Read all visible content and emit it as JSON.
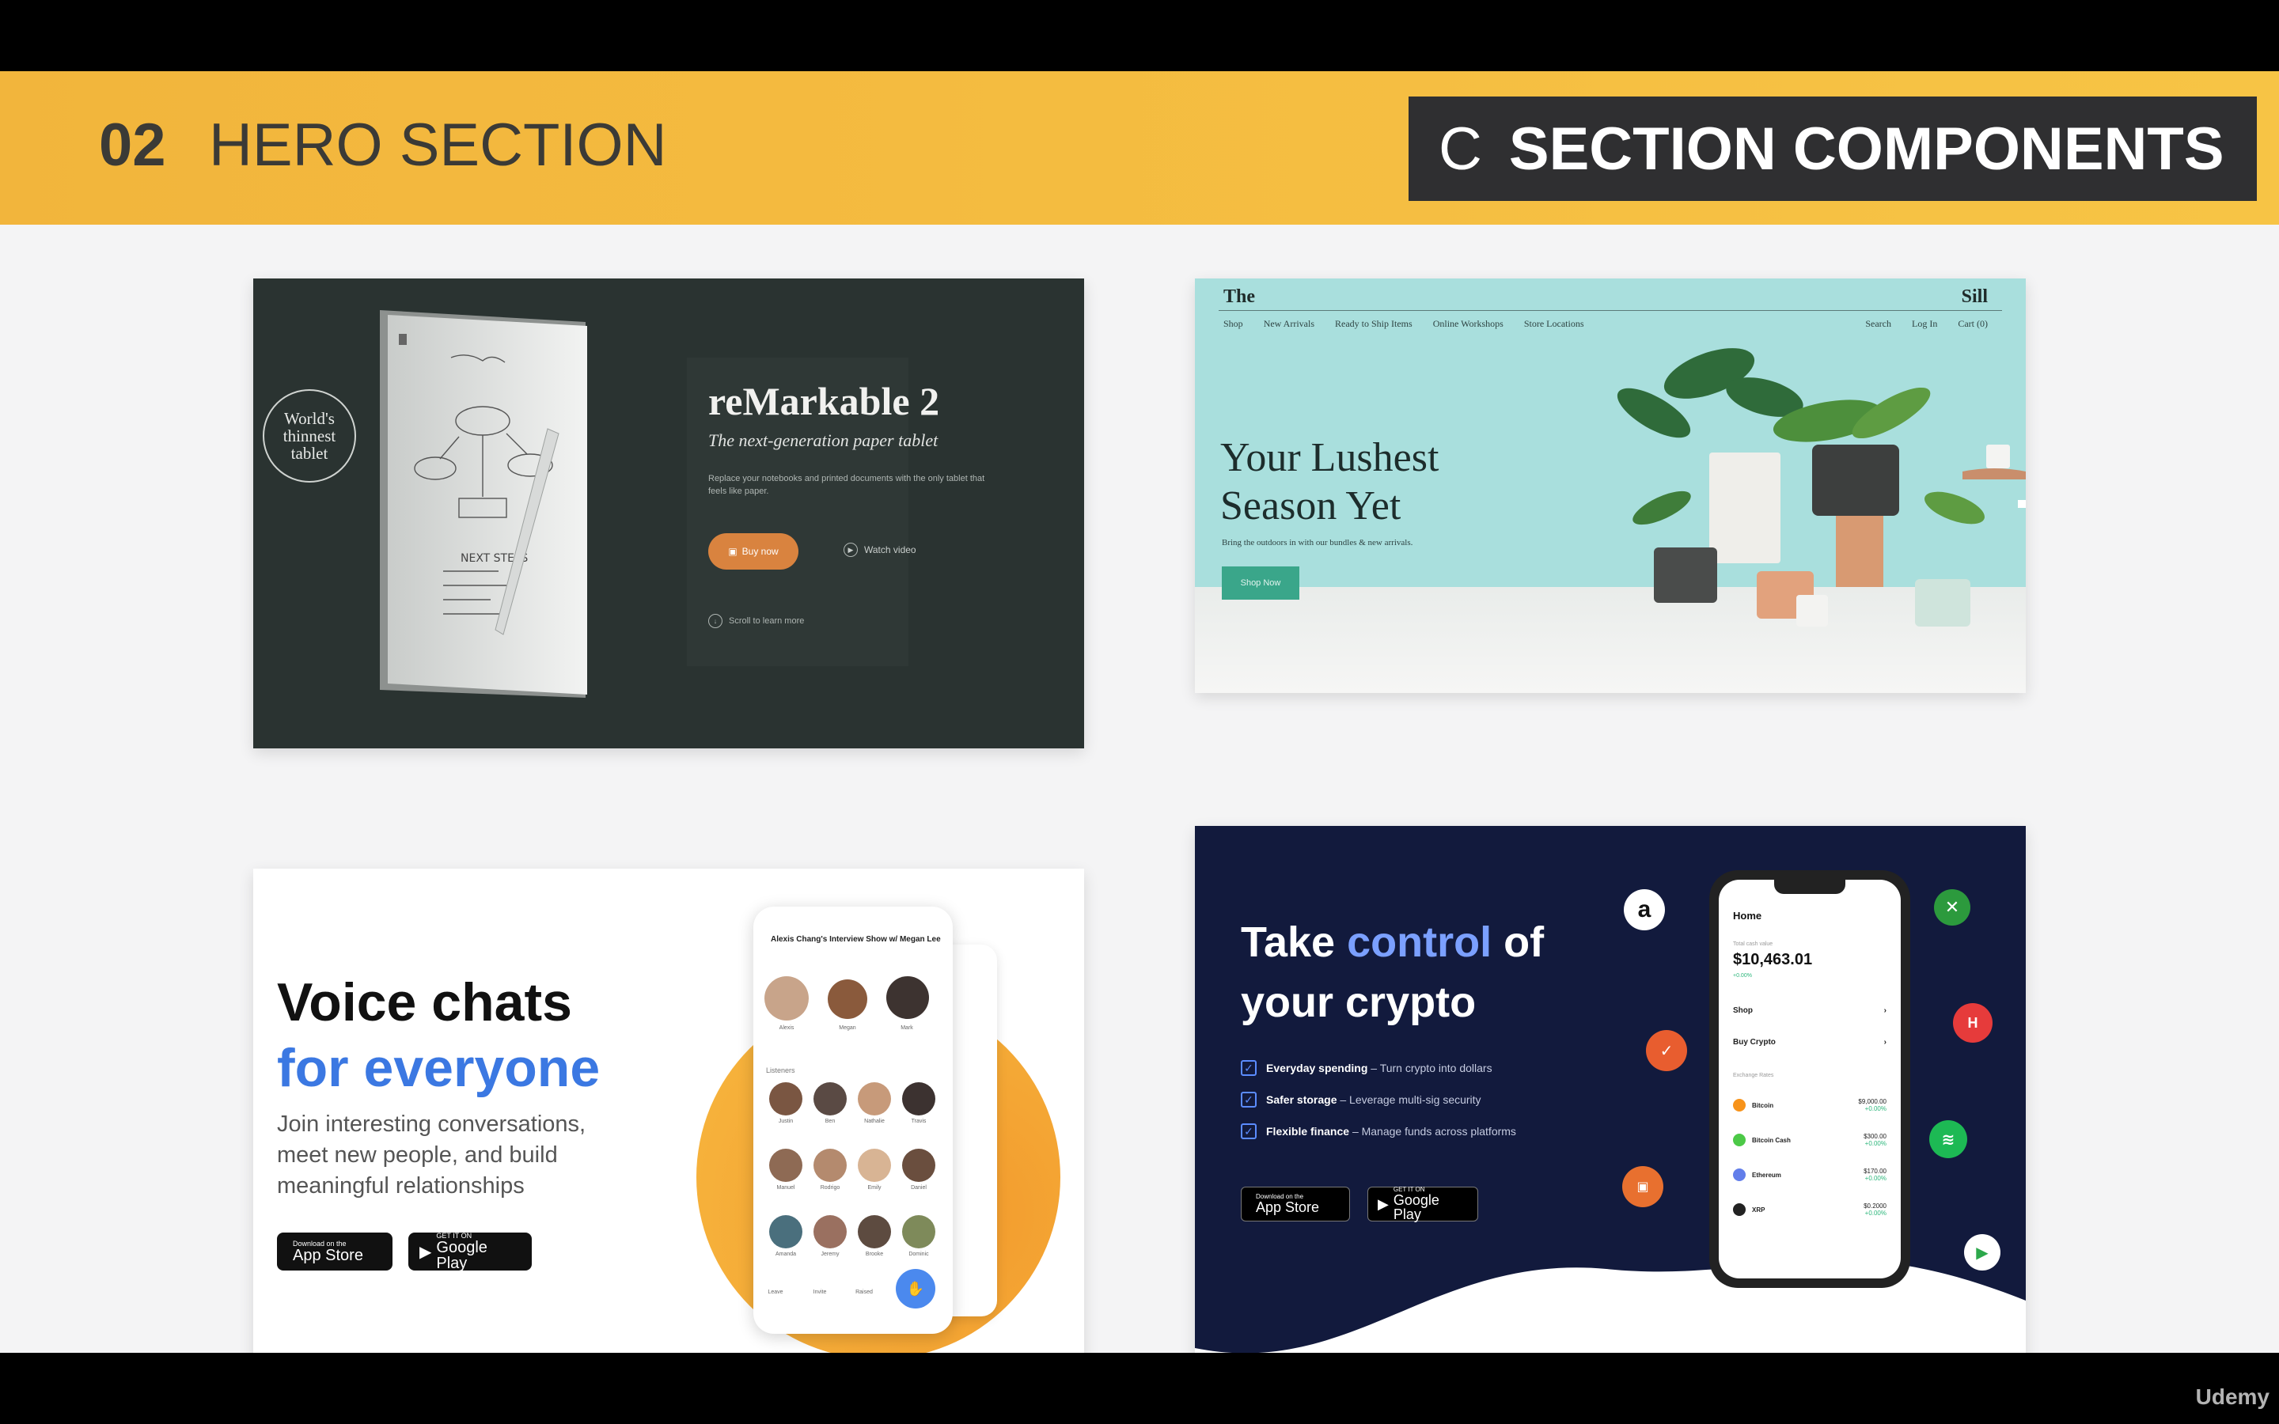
{
  "banner": {
    "number": "02",
    "title": "HERO SECTION",
    "box_letter": "C",
    "box_title": "SECTION COMPONENTS"
  },
  "remarkable": {
    "badge": "World's thinnest tablet",
    "title": "reMarkable 2",
    "subtitle": "The next-generation paper tablet",
    "description": "Replace your notebooks and printed documents with the only tablet that feels like paper.",
    "buy_label": "Buy now",
    "watch_label": "Watch video",
    "scroll_label": "Scroll to learn more",
    "accent_color": "#d9833f"
  },
  "sill": {
    "logo_left": "The",
    "logo_right": "Sill",
    "nav": [
      "Shop",
      "New Arrivals",
      "Ready to Ship Items",
      "Online Workshops",
      "Store Locations"
    ],
    "nav_right": [
      "Search",
      "Log In",
      "Cart (0)"
    ],
    "headline": "Your Lushest Season Yet",
    "subhead": "Bring the outdoors in with our bundles & new arrivals.",
    "cta": "Shop Now",
    "accent_color": "#3aa68a"
  },
  "clubhouse": {
    "headline_line1": "Voice chats",
    "headline_line2": "for everyone",
    "subtext": "Join interesting conversations, meet new people, and build meaningful relationships",
    "app_store_small": "Download on the",
    "app_store_big": "App Store",
    "google_small": "GET IT ON",
    "google_big": "Google Play",
    "room_title": "Alexis Chang's Interview Show w/ Megan Lee",
    "listeners_label": "Listeners",
    "speakers": [
      "Alexis",
      "Megan",
      "Mark"
    ],
    "listeners": [
      "Justin",
      "Ben",
      "Nathalie",
      "Travis",
      "Manuel",
      "Rodrigo",
      "Emily",
      "Daniel",
      "Amanda",
      "Jeremy",
      "Brooke",
      "Dominic"
    ],
    "actions": [
      "Leave",
      "Invite",
      "Raised"
    ],
    "accent_color": "#3b78e2"
  },
  "crypto": {
    "headline_pre": "Take ",
    "headline_accent": "control",
    "headline_post": " of",
    "headline_line2": "your crypto",
    "features": [
      {
        "bold": "Everyday spending",
        "text": "– Turn crypto into dollars"
      },
      {
        "bold": "Safer storage",
        "text": "– Leverage multi-sig security"
      },
      {
        "bold": "Flexible finance",
        "text": "– Manage funds across platforms"
      }
    ],
    "app_store_small": "Download on the",
    "app_store_big": "App Store",
    "google_small": "GET IT ON",
    "google_big": "Google Play",
    "phone": {
      "home": "Home",
      "balance_label": "Total cash value",
      "balance": "$10,463.01",
      "change": "+0.00%",
      "menu": [
        "Shop",
        "Buy Crypto"
      ],
      "rates_label": "Exchange Rates",
      "coins": [
        {
          "name": "Bitcoin",
          "price": "$9,000.00",
          "change": "+0.00%",
          "color": "#f7931a"
        },
        {
          "name": "Bitcoin Cash",
          "price": "$300.00",
          "change": "+0.00%",
          "color": "#4cc947"
        },
        {
          "name": "Ethereum",
          "price": "$170.00",
          "change": "+0.00%",
          "color": "#627eea"
        },
        {
          "name": "XRP",
          "price": "$0.2000",
          "change": "+0.00%",
          "color": "#222222"
        }
      ]
    },
    "accent_color": "#7ba0ff"
  },
  "watermark": "Udemy"
}
